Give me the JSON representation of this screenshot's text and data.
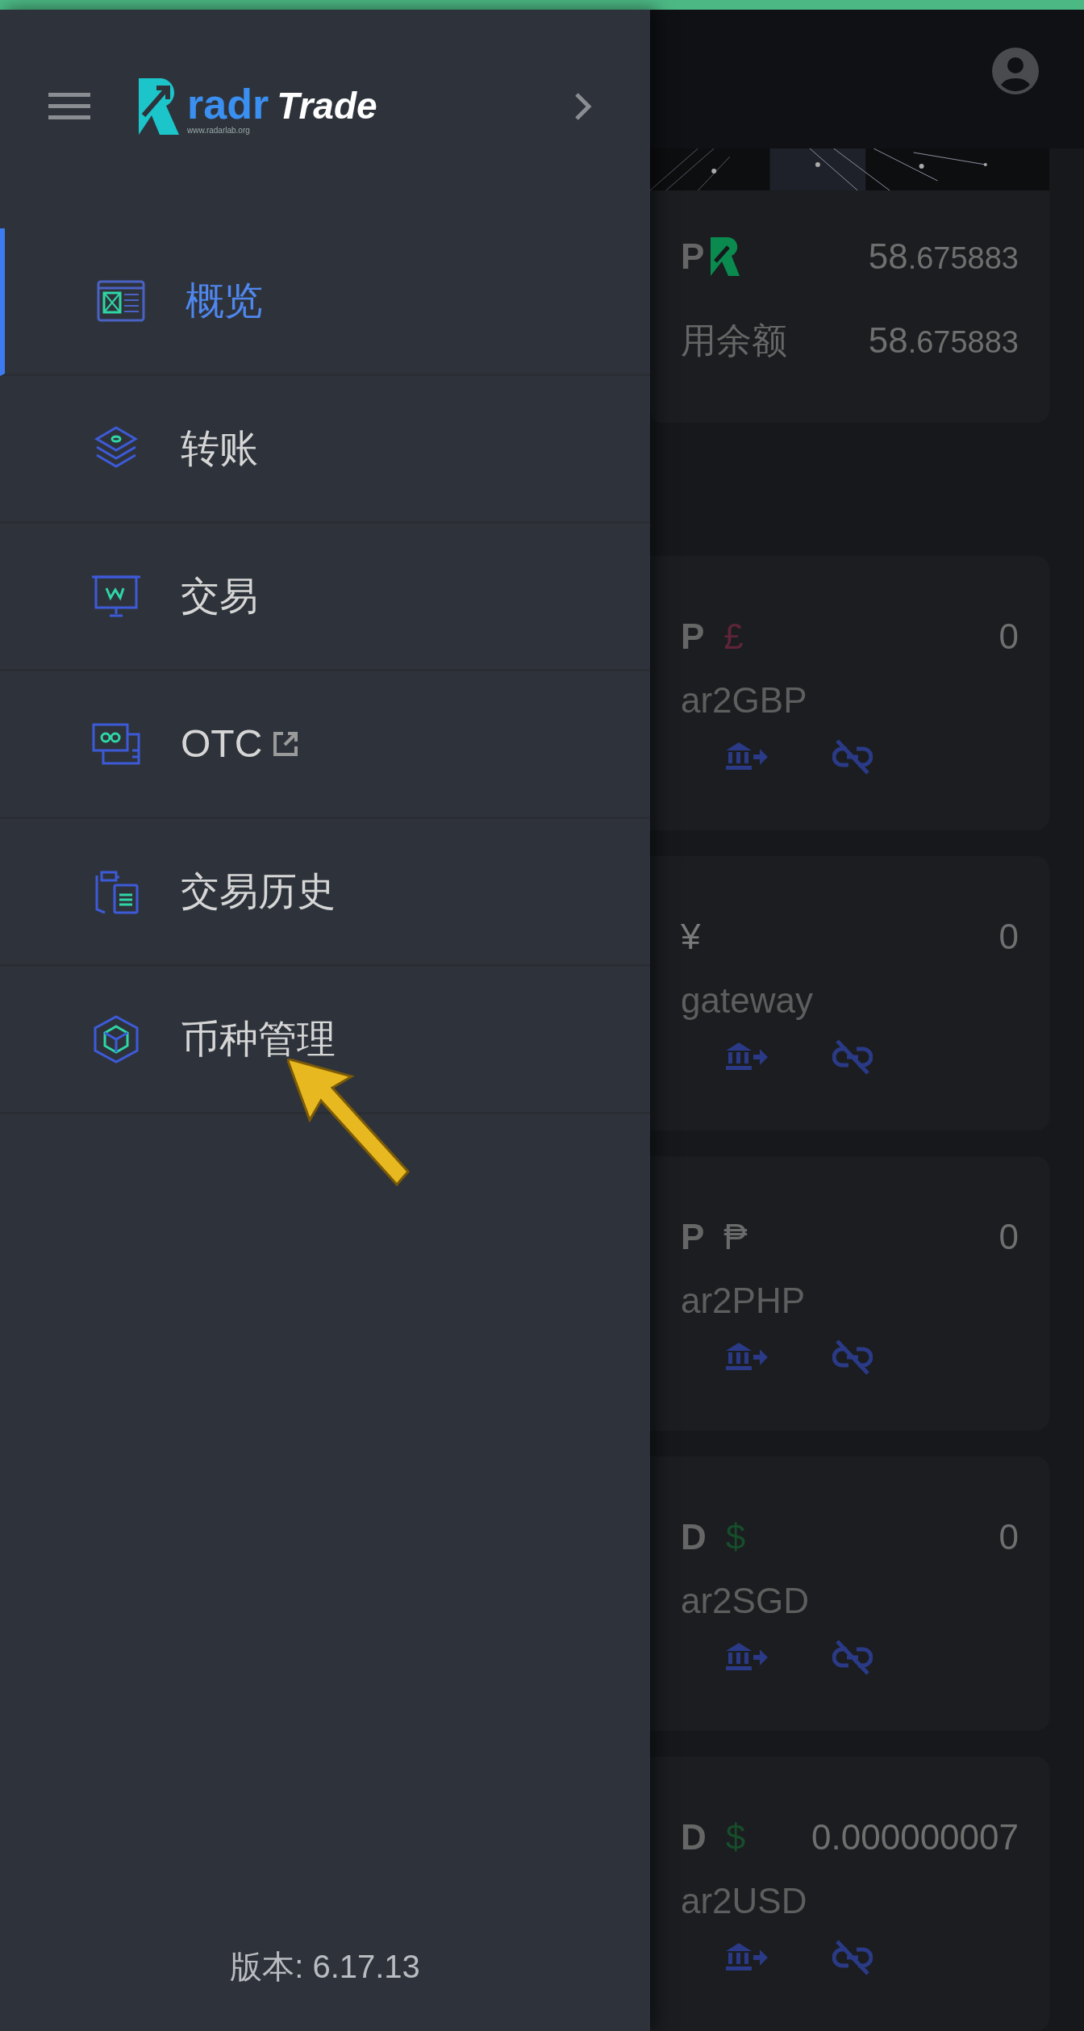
{
  "sidebar": {
    "logo": {
      "brand": "radr",
      "product": "Trade",
      "url": "www.radarlab.org"
    },
    "items": [
      {
        "label": "概览",
        "selected": true,
        "external": false
      },
      {
        "label": "转账",
        "selected": false,
        "external": false
      },
      {
        "label": "交易",
        "selected": false,
        "external": false
      },
      {
        "label": "OTC",
        "selected": false,
        "external": true
      },
      {
        "label": "交易历史",
        "selected": false,
        "external": false
      },
      {
        "label": "币种管理",
        "selected": false,
        "external": false
      }
    ],
    "version": "版本: 6.17.13"
  },
  "summary": {
    "code": "P",
    "rows": [
      {
        "int": "58",
        "frac": ".675883"
      },
      {
        "label": "用余额",
        "int": "58",
        "frac": ".675883"
      }
    ]
  },
  "cards": [
    {
      "code": "P",
      "symbol": "£",
      "color": "#5e2438",
      "amount": "0",
      "name": "ar2GBP"
    },
    {
      "symbol": "¥",
      "color": "#7a7a7a",
      "amount": "0",
      "name": "gateway"
    },
    {
      "code": "P",
      "symbol": "₱",
      "color": "#6a6a6a",
      "amount": "0",
      "name": "ar2PHP"
    },
    {
      "code": "D",
      "symbol": "$",
      "color": "#174d2b",
      "amount": "0",
      "name": "ar2SGD"
    },
    {
      "code": "D",
      "symbol": "$",
      "color": "#174d2b",
      "amount": "0.000000007",
      "name": "ar2USD"
    }
  ]
}
